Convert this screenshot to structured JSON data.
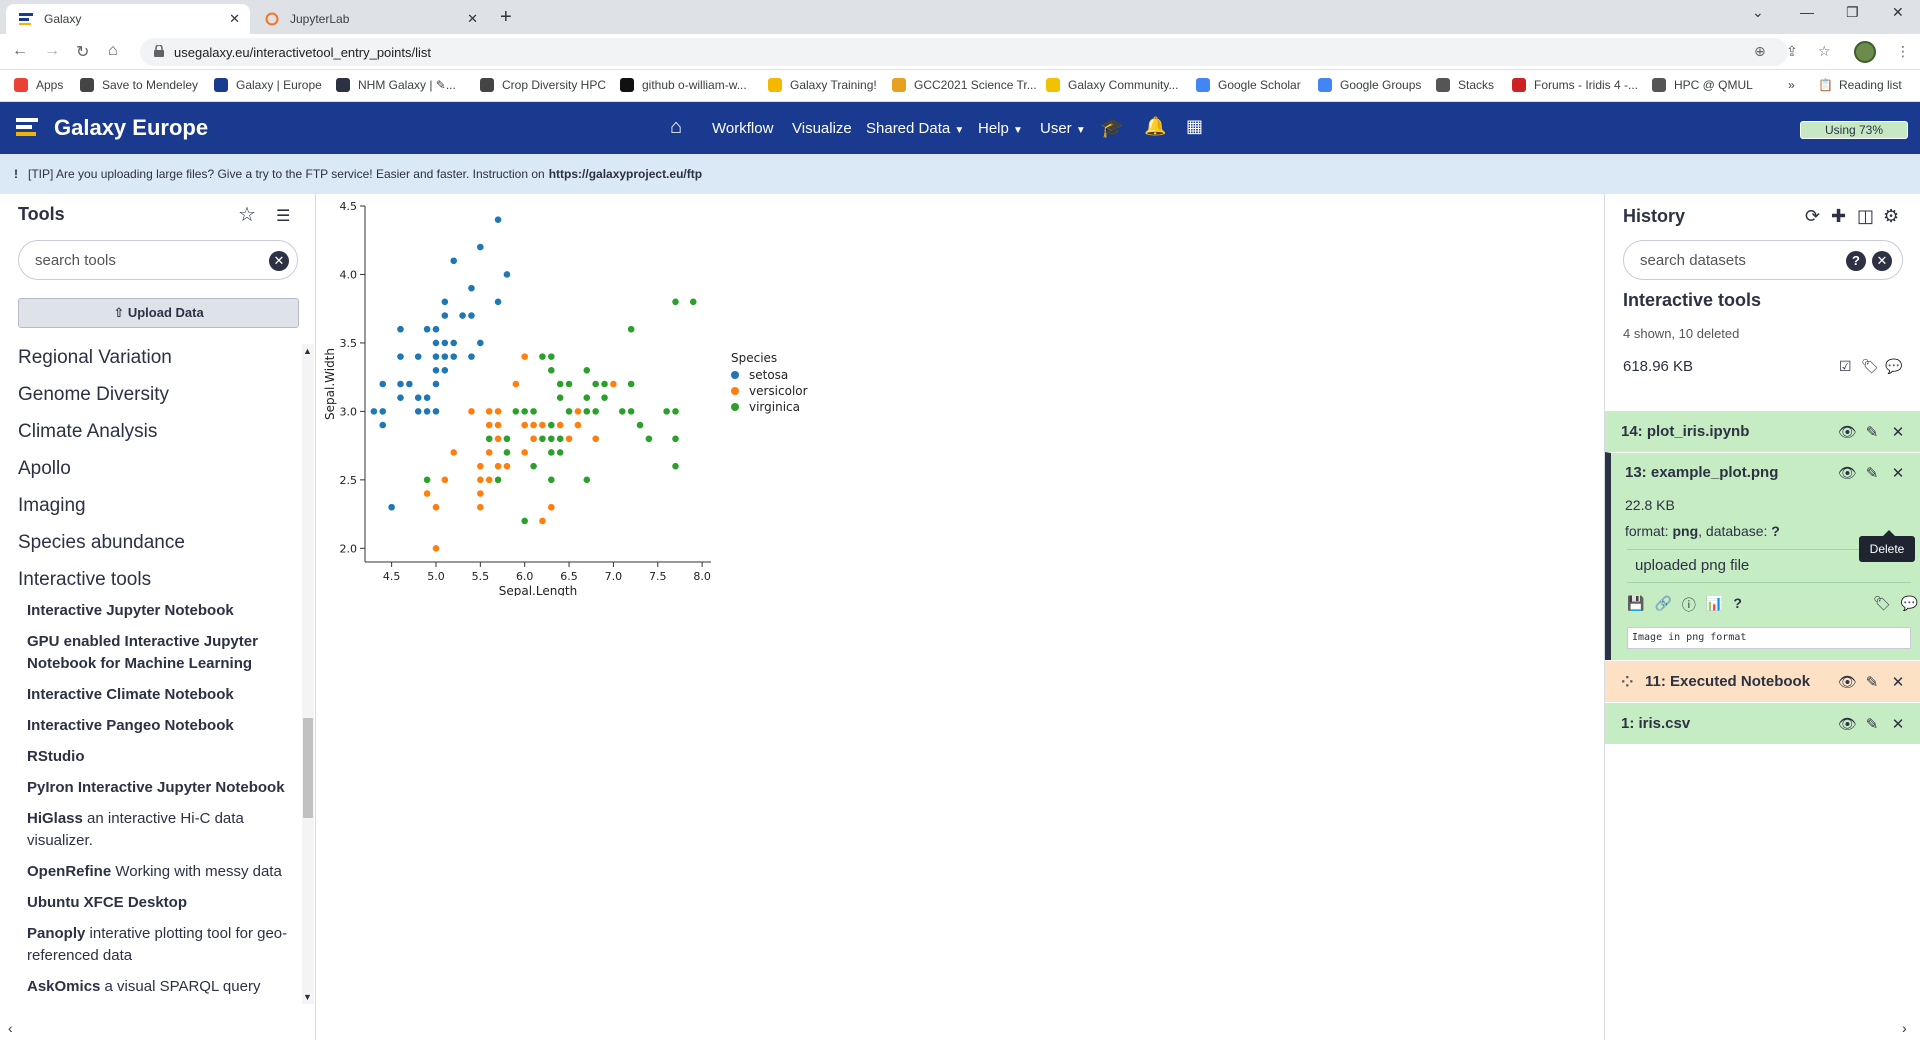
{
  "browser": {
    "tabs": [
      {
        "title": "Galaxy",
        "active": true
      },
      {
        "title": "JupyterLab",
        "active": false
      }
    ],
    "url": "usegalaxy.eu/interactivetool_entry_points/list",
    "bookmarks": [
      {
        "label": "Apps",
        "color": "#ea4335"
      },
      {
        "label": "Save to Mendeley",
        "color": "#444444"
      },
      {
        "label": "Galaxy | Europe",
        "color": "#1a3a8f"
      },
      {
        "label": "NHM Galaxy | ✎...",
        "color": "#2c3143"
      },
      {
        "label": "Crop Diversity HPC",
        "color": "#444444"
      },
      {
        "label": "github o-william-w...",
        "color": "#111111"
      },
      {
        "label": "Galaxy Training!",
        "color": "#f5b800"
      },
      {
        "label": "GCC2021 Science Tr...",
        "color": "#e8a020"
      },
      {
        "label": "Galaxy Community...",
        "color": "#f2c200"
      },
      {
        "label": "Google Scholar",
        "color": "#4285f4"
      },
      {
        "label": "Google Groups",
        "color": "#4285f4"
      },
      {
        "label": "Stacks",
        "color": "#555555"
      },
      {
        "label": "Forums - Iridis 4 -...",
        "color": "#cc2222"
      },
      {
        "label": "HPC @ QMUL",
        "color": "#555555"
      }
    ],
    "more_bookmarks": "»",
    "reading_list": "Reading list"
  },
  "masthead": {
    "brand": "Galaxy Europe",
    "nav": [
      "Workflow",
      "Visualize",
      "Shared Data",
      "Help",
      "User"
    ],
    "quota": "Using 73%"
  },
  "tip": {
    "prefix": "[TIP] Are you uploading large files? Give a try to the FTP service! Easier and faster. Instruction on ",
    "link": "https://galaxyproject.eu/ftp"
  },
  "tools": {
    "title": "Tools",
    "search_placeholder": "search tools",
    "upload_label": "Upload Data",
    "sections": [
      "Regional Variation",
      "Genome Diversity",
      "Climate Analysis",
      "Apollo",
      "Imaging",
      "Species abundance",
      "Interactive tools"
    ],
    "items": [
      {
        "name": "Interactive Jupyter Notebook",
        "desc": ""
      },
      {
        "name": "GPU enabled Interactive Jupyter Notebook for Machine Learning",
        "desc": ""
      },
      {
        "name": "Interactive Climate Notebook",
        "desc": ""
      },
      {
        "name": "Interactive Pangeo Notebook",
        "desc": ""
      },
      {
        "name": "RStudio",
        "desc": ""
      },
      {
        "name": "PyIron Interactive Jupyter Notebook",
        "desc": ""
      },
      {
        "name": "HiGlass",
        "desc": " an interactive Hi-C data visualizer."
      },
      {
        "name": "OpenRefine",
        "desc": " Working with messy data"
      },
      {
        "name": "Ubuntu XFCE Desktop",
        "desc": ""
      },
      {
        "name": "Panoply",
        "desc": " interative plotting tool for geo-referenced data"
      },
      {
        "name": "AskOmics",
        "desc": " a visual SPARQL query"
      }
    ]
  },
  "history": {
    "title": "History",
    "search_placeholder": "search datasets",
    "name": "Interactive tools",
    "counts": "4 shown, 10 deleted",
    "size": "618.96 KB",
    "datasets": [
      {
        "title": "14: plot_iris.ipynb",
        "state": "ok"
      },
      {
        "title": "13: example_plot.png",
        "state": "ok",
        "size": "22.8 KB",
        "format_label": "format: ",
        "format": "png",
        "db_label": ", database: ",
        "db": "?",
        "peek": "uploaded png file",
        "info": "Image in png format"
      },
      {
        "title": "11: Executed Notebook",
        "state": "running"
      },
      {
        "title": "1: iris.csv",
        "state": "ok"
      }
    ],
    "tooltip": "Delete"
  },
  "chart_data": {
    "type": "scatter",
    "title": "",
    "xlabel": "Sepal.Length",
    "ylabel": "Sepal.Width",
    "xlim": [
      4.2,
      8.1
    ],
    "ylim": [
      1.9,
      4.5
    ],
    "xticks": [
      "4.5",
      "5.0",
      "5.5",
      "6.0",
      "6.5",
      "7.0",
      "7.5",
      "8.0"
    ],
    "yticks": [
      "2.0",
      "2.5",
      "3.0",
      "3.5",
      "4.0",
      "4.5"
    ],
    "legend_title": "Species",
    "legend_position": "right",
    "series": [
      {
        "name": "setosa",
        "color": "#1f77b4",
        "points": [
          [
            5.1,
            3.5
          ],
          [
            4.9,
            3.0
          ],
          [
            4.7,
            3.2
          ],
          [
            4.6,
            3.1
          ],
          [
            5.0,
            3.6
          ],
          [
            5.4,
            3.9
          ],
          [
            4.6,
            3.4
          ],
          [
            5.0,
            3.4
          ],
          [
            4.4,
            2.9
          ],
          [
            4.9,
            3.1
          ],
          [
            5.4,
            3.7
          ],
          [
            4.8,
            3.4
          ],
          [
            4.8,
            3.0
          ],
          [
            4.3,
            3.0
          ],
          [
            5.8,
            4.0
          ],
          [
            5.7,
            4.4
          ],
          [
            5.4,
            3.9
          ],
          [
            5.1,
            3.5
          ],
          [
            5.7,
            3.8
          ],
          [
            5.1,
            3.8
          ],
          [
            5.4,
            3.4
          ],
          [
            5.1,
            3.7
          ],
          [
            4.6,
            3.6
          ],
          [
            5.1,
            3.3
          ],
          [
            4.8,
            3.4
          ],
          [
            5.0,
            3.0
          ],
          [
            5.0,
            3.4
          ],
          [
            5.2,
            3.5
          ],
          [
            5.2,
            3.4
          ],
          [
            4.7,
            3.2
          ],
          [
            4.8,
            3.1
          ],
          [
            5.4,
            3.4
          ],
          [
            5.2,
            4.1
          ],
          [
            5.5,
            4.2
          ],
          [
            4.9,
            3.1
          ],
          [
            5.0,
            3.2
          ],
          [
            5.5,
            3.5
          ],
          [
            4.9,
            3.6
          ],
          [
            4.4,
            3.0
          ],
          [
            5.1,
            3.4
          ],
          [
            5.0,
            3.5
          ],
          [
            4.5,
            2.3
          ],
          [
            4.4,
            3.2
          ],
          [
            5.0,
            3.5
          ],
          [
            5.1,
            3.8
          ],
          [
            4.8,
            3.0
          ],
          [
            5.1,
            3.8
          ],
          [
            4.6,
            3.2
          ],
          [
            5.3,
            3.7
          ],
          [
            5.0,
            3.3
          ]
        ]
      },
      {
        "name": "versicolor",
        "color": "#ff7f0e",
        "points": [
          [
            7.0,
            3.2
          ],
          [
            6.4,
            3.2
          ],
          [
            6.9,
            3.1
          ],
          [
            5.5,
            2.3
          ],
          [
            6.5,
            2.8
          ],
          [
            5.7,
            2.8
          ],
          [
            6.3,
            3.3
          ],
          [
            4.9,
            2.4
          ],
          [
            6.6,
            2.9
          ],
          [
            5.2,
            2.7
          ],
          [
            5.0,
            2.0
          ],
          [
            5.9,
            3.0
          ],
          [
            6.0,
            2.2
          ],
          [
            6.1,
            2.9
          ],
          [
            5.6,
            2.9
          ],
          [
            6.7,
            3.1
          ],
          [
            5.6,
            3.0
          ],
          [
            5.8,
            2.7
          ],
          [
            6.2,
            2.2
          ],
          [
            5.6,
            2.5
          ],
          [
            5.9,
            3.2
          ],
          [
            6.1,
            2.8
          ],
          [
            6.3,
            2.5
          ],
          [
            6.1,
            2.8
          ],
          [
            6.4,
            2.9
          ],
          [
            6.6,
            3.0
          ],
          [
            6.8,
            2.8
          ],
          [
            6.7,
            3.0
          ],
          [
            6.0,
            2.9
          ],
          [
            5.7,
            2.6
          ],
          [
            5.5,
            2.4
          ],
          [
            5.5,
            2.4
          ],
          [
            5.8,
            2.7
          ],
          [
            6.0,
            2.7
          ],
          [
            5.4,
            3.0
          ],
          [
            6.0,
            3.4
          ],
          [
            6.7,
            3.1
          ],
          [
            6.3,
            2.3
          ],
          [
            5.6,
            3.0
          ],
          [
            5.5,
            2.5
          ],
          [
            5.5,
            2.6
          ],
          [
            6.1,
            3.0
          ],
          [
            5.8,
            2.6
          ],
          [
            5.0,
            2.3
          ],
          [
            5.6,
            2.7
          ],
          [
            5.7,
            3.0
          ],
          [
            5.7,
            2.9
          ],
          [
            6.2,
            2.9
          ],
          [
            5.1,
            2.5
          ],
          [
            5.7,
            2.8
          ]
        ]
      },
      {
        "name": "virginica",
        "color": "#2ca02c",
        "points": [
          [
            6.3,
            3.3
          ],
          [
            5.8,
            2.7
          ],
          [
            7.1,
            3.0
          ],
          [
            6.3,
            2.9
          ],
          [
            6.5,
            3.0
          ],
          [
            7.6,
            3.0
          ],
          [
            4.9,
            2.5
          ],
          [
            7.3,
            2.9
          ],
          [
            6.7,
            2.5
          ],
          [
            7.2,
            3.6
          ],
          [
            6.5,
            3.2
          ],
          [
            6.4,
            2.7
          ],
          [
            6.8,
            3.0
          ],
          [
            5.7,
            2.5
          ],
          [
            5.8,
            2.8
          ],
          [
            6.4,
            3.2
          ],
          [
            6.5,
            3.0
          ],
          [
            7.7,
            3.8
          ],
          [
            7.7,
            2.6
          ],
          [
            6.0,
            2.2
          ],
          [
            6.9,
            3.2
          ],
          [
            5.6,
            2.8
          ],
          [
            7.7,
            2.8
          ],
          [
            6.3,
            2.7
          ],
          [
            6.7,
            3.3
          ],
          [
            7.2,
            3.2
          ],
          [
            6.2,
            2.8
          ],
          [
            6.1,
            3.0
          ],
          [
            6.4,
            2.8
          ],
          [
            7.2,
            3.0
          ],
          [
            7.4,
            2.8
          ],
          [
            7.9,
            3.8
          ],
          [
            6.4,
            2.8
          ],
          [
            6.3,
            2.8
          ],
          [
            6.1,
            2.6
          ],
          [
            7.7,
            3.0
          ],
          [
            6.3,
            3.4
          ],
          [
            6.4,
            3.1
          ],
          [
            6.0,
            3.0
          ],
          [
            6.9,
            3.1
          ],
          [
            6.7,
            3.1
          ],
          [
            6.9,
            3.1
          ],
          [
            5.8,
            2.7
          ],
          [
            6.8,
            3.2
          ],
          [
            6.7,
            3.3
          ],
          [
            6.7,
            3.0
          ],
          [
            6.3,
            2.5
          ],
          [
            6.5,
            3.0
          ],
          [
            6.2,
            3.4
          ],
          [
            5.9,
            3.0
          ]
        ]
      }
    ]
  }
}
